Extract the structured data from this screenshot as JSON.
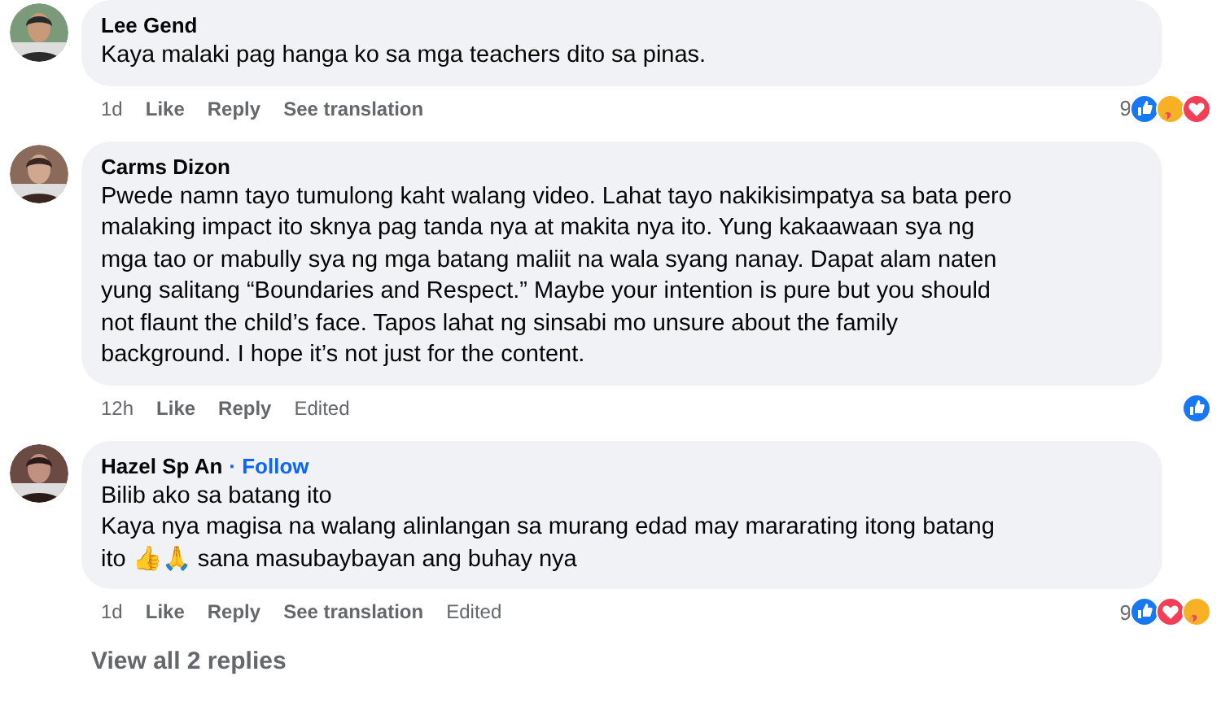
{
  "comments": [
    {
      "author": "Lee Gend",
      "body": "Kaya malaki pag hanga ko sa mga teachers dito sa pinas.",
      "time": "1d",
      "actions": [
        "Like",
        "Reply",
        "See translation"
      ],
      "reaction_count": "9",
      "reactions": [
        {
          "kind": "like"
        },
        {
          "kind": "care"
        },
        {
          "kind": "love"
        }
      ]
    },
    {
      "author": "Carms Dizon",
      "body": "Pwede namn tayo tumulong kaht walang video. Lahat tayo nakikisimpatya sa bata pero\nmalaking impact ito sknya pag tanda nya at makita nya ito. Yung kakaawaan sya ng\nmga tao or mabully sya ng mga batang maliit na wala syang nanay. Dapat alam naten\nyung salitang “Boundaries and Respect.” Maybe your intention is pure but you should\nnot flaunt the child’s face. Tapos lahat ng sinsabi mo unsure about the family\nbackground. I hope it’s not just for the content.",
      "time": "12h",
      "actions": [
        "Like",
        "Reply"
      ],
      "edited": "Edited",
      "reactions": [
        {
          "kind": "like"
        }
      ]
    },
    {
      "author": "Hazel Sp An",
      "follow": "· Follow",
      "body": "Bilib ako sa batang ito\nKaya nya magisa na walang alinlangan sa murang edad may mararating itong batang\nito 👍🙏 sana masubaybayan ang buhay nya",
      "time": "1d",
      "actions": [
        "Like",
        "Reply",
        "See translation"
      ],
      "edited": "Edited",
      "reaction_count": "9",
      "reactions": [
        {
          "kind": "like"
        },
        {
          "kind": "love"
        },
        {
          "kind": "care"
        }
      ]
    }
  ],
  "view_replies": "View all 2 replies"
}
